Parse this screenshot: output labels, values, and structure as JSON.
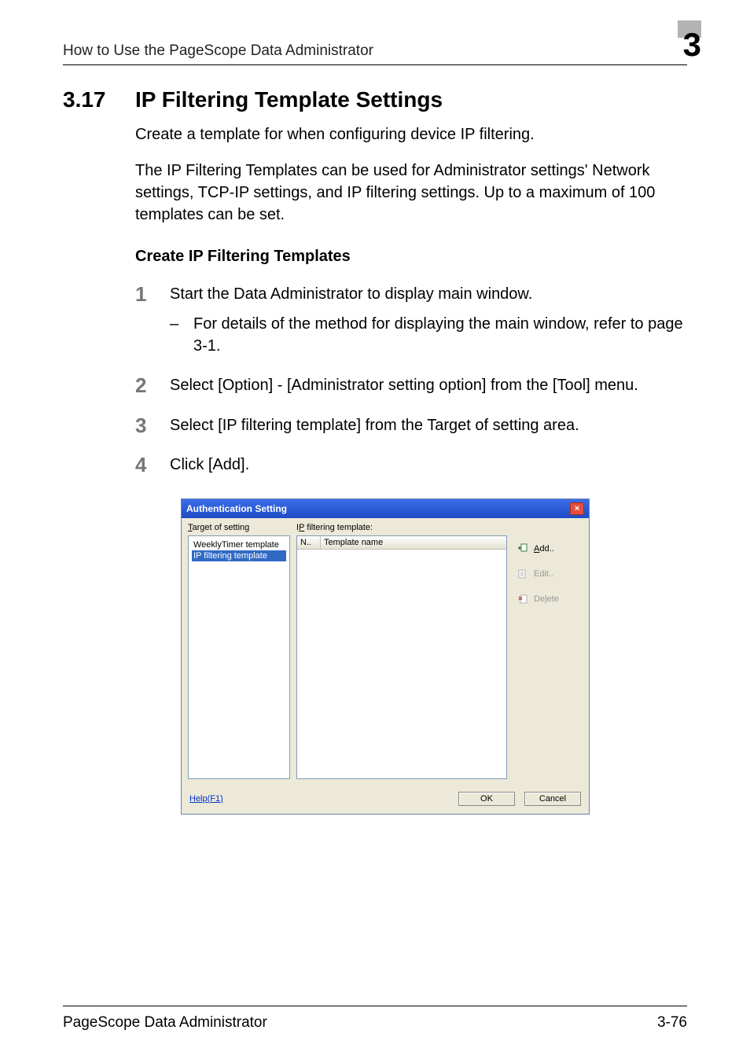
{
  "header": {
    "running_title": "How to Use the PageScope Data Administrator",
    "chapter_number": "3"
  },
  "section": {
    "number": "3.17",
    "title": "IP Filtering Template Settings"
  },
  "intro": {
    "p1": "Create a template for when configuring device IP filtering.",
    "p2": "The IP Filtering Templates can be used for Administrator settings' Network settings, TCP-IP settings, and IP filtering settings. Up to a maximum of 100 templates can be set."
  },
  "sub_heading": "Create IP Filtering Templates",
  "steps": [
    {
      "num": "1",
      "text": "Start the Data Administrator to display main window.",
      "sub": "For details of the method for displaying the main window, refer to page 3-1."
    },
    {
      "num": "2",
      "text": "Select [Option] - [Administrator setting option] from the [Tool] menu."
    },
    {
      "num": "3",
      "text": "Select [IP filtering template] from the Target of setting area."
    },
    {
      "num": "4",
      "text": "Click [Add]."
    }
  ],
  "dialog": {
    "title": "Authentication Setting",
    "close_glyph": "×",
    "target_of_setting_label": "Target of setting",
    "tree_node1": "WeeklyTimer template",
    "tree_node2": "IP filtering template",
    "ip_filtering_label": "IP filtering template:",
    "col_n": "N..",
    "col_name": "Template name",
    "btn_add": "Add..",
    "btn_edit": "Edit..",
    "btn_delete": "Delete",
    "help": "Help(F1)",
    "ok": "OK",
    "cancel": "Cancel"
  },
  "footer": {
    "left": "PageScope Data Administrator",
    "right": "3-76"
  }
}
